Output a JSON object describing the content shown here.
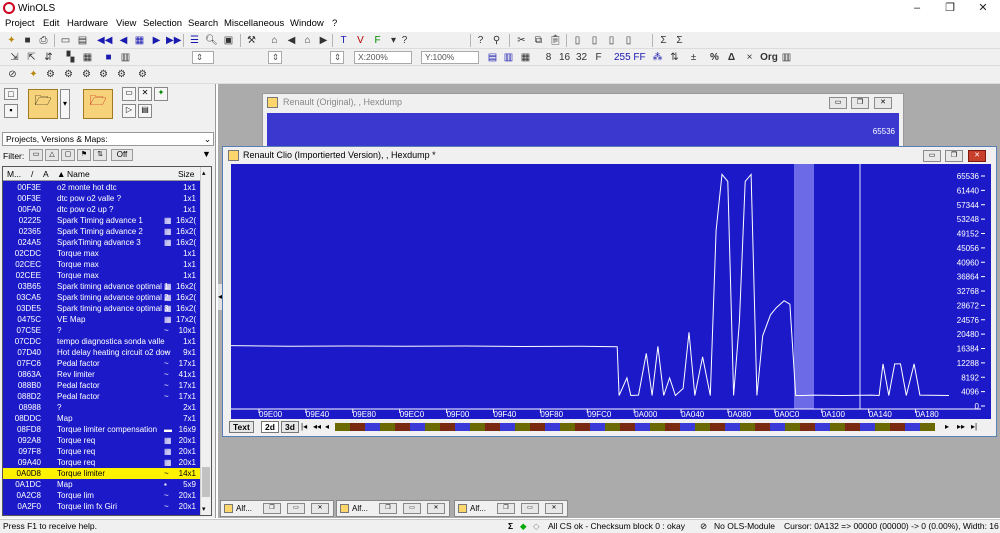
{
  "app": {
    "title": "WinOLS"
  },
  "window_controls": {
    "minimize": "–",
    "restore": "❐",
    "close": "✕"
  },
  "menu": [
    "Project",
    "Edit",
    "Hardware",
    "View",
    "Selection",
    "Search",
    "Miscellaneous",
    "Window",
    "?"
  ],
  "toolbar": {
    "x_zoom": "X:200%",
    "y_zoom": "Y:100%",
    "labels_right": [
      "%",
      "Org"
    ]
  },
  "left_panel": {
    "combo_value": "Projects, Versions & Maps:",
    "filter_label": "Filter:",
    "filter_off": "Off",
    "columns": {
      "m": "M...",
      "a": "A",
      "name": "Name",
      "size": "Size"
    },
    "rows": [
      {
        "addr": "00F3E",
        "name": "o2 monte hot dtc",
        "size": "1x1",
        "mark": ""
      },
      {
        "addr": "00F3E",
        "name": "dtc pow o2 valle ?",
        "size": "1x1",
        "mark": ""
      },
      {
        "addr": "00FA0",
        "name": "dtc pow o2 up ?",
        "size": "1x1",
        "mark": ""
      },
      {
        "addr": "02225",
        "name": "Spark Timing advance 1",
        "size": "16x2(",
        "mark": "▦"
      },
      {
        "addr": "02365",
        "name": "Spark Timing advance  2",
        "size": "16x2(",
        "mark": "▦"
      },
      {
        "addr": "024A5",
        "name": "SparkTiming advance 3",
        "size": "16x2(",
        "mark": "▦"
      },
      {
        "addr": "02CDC",
        "name": "Torque max",
        "size": "1x1",
        "mark": ""
      },
      {
        "addr": "02CEC",
        "name": "Torque max",
        "size": "1x1",
        "mark": ""
      },
      {
        "addr": "02CEE",
        "name": "Torque max",
        "size": "1x1",
        "mark": ""
      },
      {
        "addr": "03B65",
        "name": "Spark timing advance optimal 1",
        "size": "16x2(",
        "mark": "▦"
      },
      {
        "addr": "03CA5",
        "name": "Spark timing advance optimal 2",
        "size": "16x2(",
        "mark": "▦"
      },
      {
        "addr": "03DE5",
        "name": "Spark timing advance optimal 3",
        "size": "16x2(",
        "mark": "▦"
      },
      {
        "addr": "0475C",
        "name": "VE Map",
        "size": "17x2(",
        "mark": "▦"
      },
      {
        "addr": "07C5E",
        "name": "?",
        "size": "10x1",
        "mark": "~"
      },
      {
        "addr": "07CDC",
        "name": "tempo diagnostica sonda valle",
        "size": "1x1",
        "mark": ""
      },
      {
        "addr": "07D40",
        "name": "Hot delay heating circuit o2 dow",
        "size": "9x1",
        "mark": "~"
      },
      {
        "addr": "07FC6",
        "name": "Pedal factor",
        "size": "17x1",
        "mark": "~"
      },
      {
        "addr": "0863A",
        "name": "Rev limiter",
        "size": "41x1",
        "mark": "~"
      },
      {
        "addr": "088B0",
        "name": "Pedal factor",
        "size": "17x1",
        "mark": "~"
      },
      {
        "addr": "088D2",
        "name": "Pedal factor",
        "size": "17x1",
        "mark": "~"
      },
      {
        "addr": "08988",
        "name": "?",
        "size": "2x1",
        "mark": ""
      },
      {
        "addr": "08DDC",
        "name": "Map",
        "size": "7x1",
        "mark": ""
      },
      {
        "addr": "08FD8",
        "name": "Torque limiter compensation",
        "size": "16x9",
        "mark": "▬"
      },
      {
        "addr": "092A8",
        "name": "Torque req",
        "size": "20x1",
        "mark": "▦"
      },
      {
        "addr": "097F8",
        "name": "Torque req",
        "size": "20x1",
        "mark": "▦"
      },
      {
        "addr": "09A40",
        "name": "Torque req",
        "size": "20x1",
        "mark": "▦"
      },
      {
        "addr": "0A0D8",
        "name": "Torque limiter",
        "size": "14x1",
        "mark": "~",
        "selected": true
      },
      {
        "addr": "0A1DC",
        "name": "Map",
        "size": "5x9",
        "mark": "▪"
      },
      {
        "addr": "0A2C8",
        "name": "Torque lim",
        "size": "20x1",
        "mark": "~"
      },
      {
        "addr": "0A2F0",
        "name": "Torque lim fx Giri",
        "size": "20x1",
        "mark": "~"
      }
    ]
  },
  "orig_window": {
    "title": "Renault (Original), , Hexdump",
    "value": "65536"
  },
  "main_window": {
    "title": "Renault Clio (Importierted Version), , Hexdump *",
    "tabs": [
      "Text",
      "2d",
      "3d"
    ]
  },
  "chart_data": {
    "type": "line",
    "title": "",
    "x": [
      "09E00",
      "09E40",
      "09E80",
      "09EC0",
      "09F00",
      "09F40",
      "09F80",
      "09FC0",
      "0A000",
      "0A040",
      "0A080",
      "0A0C0",
      "0A100",
      "0A140",
      "0A180"
    ],
    "y_ticks": [
      0,
      4096,
      8192,
      12288,
      16384,
      20480,
      24576,
      28672,
      32768,
      36864,
      40960,
      45056,
      49152,
      53248,
      57344,
      61440,
      65536
    ],
    "ylim": [
      0,
      65536
    ],
    "xlabel": "",
    "ylabel": "",
    "series": [
      {
        "values": [
          {
            "x": 0,
            "y": 17200
          },
          {
            "x": 60,
            "y": 17000
          },
          {
            "x": 120,
            "y": 17100
          },
          {
            "x": 180,
            "y": 17000
          },
          {
            "x": 240,
            "y": 17100
          },
          {
            "x": 300,
            "y": 16950
          },
          {
            "x": 360,
            "y": 17050
          },
          {
            "x": 398,
            "y": 16900
          },
          {
            "x": 400,
            "y": 3000
          },
          {
            "x": 408,
            "y": 8000
          },
          {
            "x": 412,
            "y": 3000
          },
          {
            "x": 420,
            "y": 3100
          },
          {
            "x": 428,
            "y": 15000
          },
          {
            "x": 434,
            "y": 3000
          },
          {
            "x": 440,
            "y": 17000
          },
          {
            "x": 446,
            "y": 3000
          },
          {
            "x": 452,
            "y": 8000
          },
          {
            "x": 458,
            "y": 3000
          },
          {
            "x": 466,
            "y": 5000
          },
          {
            "x": 472,
            "y": 21000
          },
          {
            "x": 478,
            "y": 3000
          },
          {
            "x": 486,
            "y": 14000
          },
          {
            "x": 494,
            "y": 3000
          },
          {
            "x": 500,
            "y": 50000
          },
          {
            "x": 506,
            "y": 66000
          },
          {
            "x": 512,
            "y": 64000
          },
          {
            "x": 518,
            "y": 3000
          },
          {
            "x": 524,
            "y": 24000
          },
          {
            "x": 530,
            "y": 64000
          },
          {
            "x": 536,
            "y": 66000
          },
          {
            "x": 542,
            "y": 3000
          },
          {
            "x": 548,
            "y": 20000
          },
          {
            "x": 556,
            "y": 26000
          },
          {
            "x": 562,
            "y": 28000
          },
          {
            "x": 570,
            "y": 30000
          },
          {
            "x": 576,
            "y": 29000
          },
          {
            "x": 582,
            "y": 3000
          },
          {
            "x": 590,
            "y": 3000
          },
          {
            "x": 600,
            "y": 3100
          },
          {
            "x": 630,
            "y": 3000
          },
          {
            "x": 660,
            "y": 3100
          },
          {
            "x": 668,
            "y": 3000
          },
          {
            "x": 672,
            "y": 12000
          },
          {
            "x": 678,
            "y": 3000
          },
          {
            "x": 684,
            "y": 12000
          },
          {
            "x": 690,
            "y": 12000
          },
          {
            "x": 696,
            "y": 3000
          },
          {
            "x": 704,
            "y": 12000
          },
          {
            "x": 710,
            "y": 3100
          },
          {
            "x": 740,
            "y": 3000
          }
        ]
      }
    ]
  },
  "task_windows": [
    "Alf...",
    "Alf...",
    "Alf..."
  ],
  "status": {
    "left": "Press F1 to receive help.",
    "checksum": "All CS ok - Checksum block 0 : okay",
    "module": "No OLS-Module",
    "cursor": "Cursor: 0A132 => 00000 (00000) -> 0 (0.00%), Width: 16"
  }
}
